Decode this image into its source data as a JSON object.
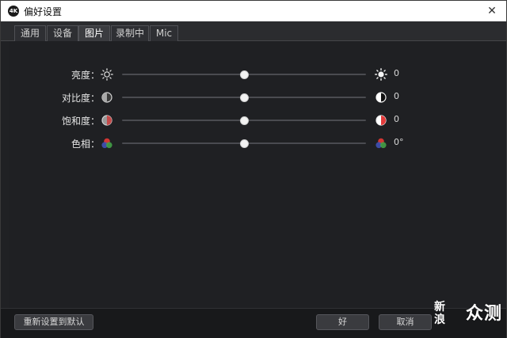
{
  "window": {
    "title": "偏好设置",
    "app_icon_text": "4K",
    "close_symbol": "✕"
  },
  "tabs": [
    {
      "label": "通用",
      "active": false
    },
    {
      "label": "设备",
      "active": false
    },
    {
      "label": "图片",
      "active": true
    },
    {
      "label": "录制中",
      "active": false
    },
    {
      "label": "Mic",
      "active": false
    }
  ],
  "picture": {
    "rows": [
      {
        "label": "亮度：",
        "value": "0",
        "slider_fraction": 0.5,
        "icon_left": "sun-outline-icon",
        "icon_right": "sun-filled-icon"
      },
      {
        "label": "对比度：",
        "value": "0",
        "slider_fraction": 0.5,
        "icon_left": "contrast-low-icon",
        "icon_right": "contrast-high-icon"
      },
      {
        "label": "饱和度：",
        "value": "0",
        "slider_fraction": 0.5,
        "icon_left": "saturation-low-icon",
        "icon_right": "saturation-high-icon"
      },
      {
        "label": "色相：",
        "value": "0°",
        "slider_fraction": 0.5,
        "icon_left": "hue-icon",
        "icon_right": "hue-icon"
      }
    ]
  },
  "footer": {
    "reset_label": "重新设置到默认",
    "ok_label": "好",
    "cancel_label": "取消"
  },
  "watermark": {
    "vertical": "新浪",
    "text": "众测"
  },
  "colors": {
    "saturation_red": "#e23b3b",
    "hue_red": "#e53935",
    "hue_green": "#43a047",
    "hue_blue": "#3f51b5"
  }
}
